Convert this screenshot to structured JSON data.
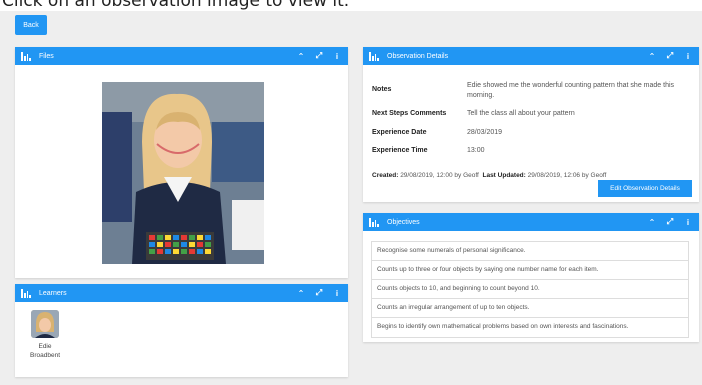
{
  "page": {
    "heading": "Click on an observation image to view it."
  },
  "toolbar": {
    "back_label": "Back"
  },
  "files": {
    "title": "Files"
  },
  "learners": {
    "title": "Learners",
    "items": [
      {
        "name": "Edie Broadbent"
      }
    ]
  },
  "observation": {
    "title": "Observation Details",
    "fields": [
      {
        "label": "Notes",
        "value": "Edie showed me the wonderful counting pattern that she made this morning."
      },
      {
        "label": "Next Steps Comments",
        "value": "Tell the class all about your pattern"
      },
      {
        "label": "Experience Date",
        "value": "28/03/2019"
      },
      {
        "label": "Experience Time",
        "value": "13:00"
      }
    ],
    "created_label": "Created:",
    "created_value": "29/08/2019, 12:00 by Geoff",
    "updated_label": "Last Updated:",
    "updated_value": "29/08/2019, 12:06 by Geoff",
    "edit_label": "Edit Observation Details"
  },
  "objectives": {
    "title": "Objectives",
    "items": [
      "Recognise some numerals of personal significance.",
      "Counts up to three or four objects by saying one number name for each item.",
      "Counts objects to 10, and beginning to count beyond 10.",
      "Counts an irregular arrangement of up to ten objects.",
      "Begins to identify own mathematical problems based on own interests and fascinations."
    ]
  },
  "icons": {
    "panel": "bar-chart-icon",
    "collapse": "chevron-up-icon",
    "expand": "expand-icon",
    "info": "info-icon"
  },
  "colors": {
    "accent": "#2196f3",
    "background": "#eeeeee"
  }
}
